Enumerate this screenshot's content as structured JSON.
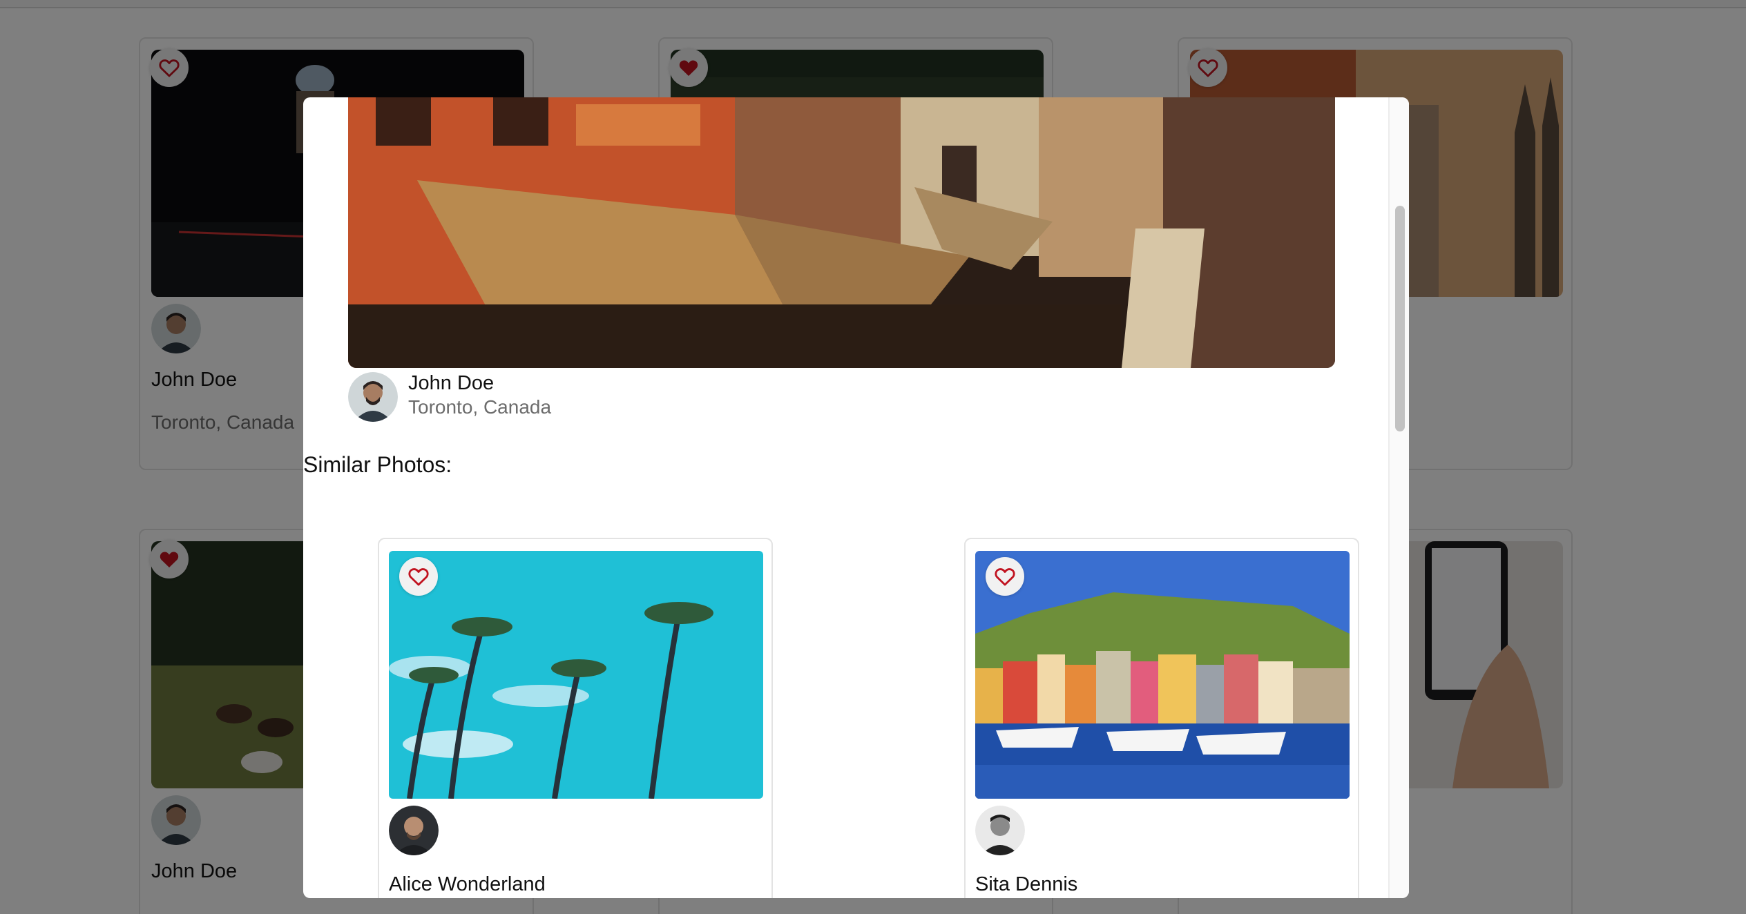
{
  "background_grid": {
    "cards": [
      {
        "owner_name": "John Doe",
        "location": "Toronto, Canada",
        "liked": false
      },
      {
        "owner_name": "",
        "location": "",
        "liked": true
      },
      {
        "owner_name": "",
        "location": "",
        "liked": false
      },
      {
        "owner_name": "John Doe",
        "location": "",
        "liked": true
      }
    ]
  },
  "modal": {
    "owner": {
      "name": "John Doe",
      "location": "Toronto, Canada"
    },
    "similar_title": "Similar Photos:",
    "similar_photos": [
      {
        "owner_name": "Alice Wonderland",
        "liked": false
      },
      {
        "owner_name": "Sita Dennis",
        "liked": false
      }
    ]
  },
  "icons": {
    "like": "heart-outline-icon",
    "liked": "heart-filled-icon"
  },
  "colors": {
    "heart": "#c1121f",
    "overlay": "rgba(0,0,0,0.5)",
    "secondary_text": "#6c6c6c"
  }
}
